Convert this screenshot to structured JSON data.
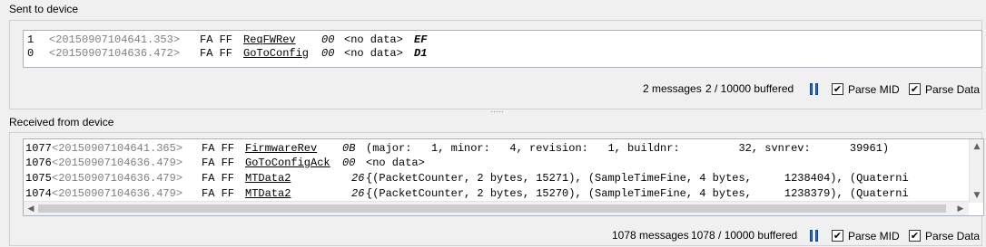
{
  "sent": {
    "title": "Sent to device",
    "rows": [
      {
        "idx": "1",
        "ts": "<20150907104641.353>",
        "hdr": "FA FF",
        "mid": "ReqFWRev",
        "len": "00",
        "data": "<no data>",
        "cs": "EF"
      },
      {
        "idx": "0",
        "ts": "<20150907104636.472>",
        "hdr": "FA FF",
        "mid": "GoToConfig",
        "len": "00",
        "data": "<no data>",
        "cs": "D1"
      }
    ],
    "status": {
      "messages": "2 messages",
      "buffered": "2 / 10000 buffered",
      "parse_mid_label": "Parse MID",
      "parse_data_label": "Parse Data",
      "parse_mid_checked": "✔",
      "parse_data_checked": "✔"
    }
  },
  "received": {
    "title": "Received from device",
    "rows": [
      {
        "idx": "1077",
        "ts": "<20150907104641.365>",
        "hdr": "FA FF",
        "mid": "FirmwareRev",
        "len": "0B",
        "data": "(major:   1, minor:   4, revision:   1, buildnr:         32, svnrev:      39961)"
      },
      {
        "idx": "1076",
        "ts": "<20150907104636.479>",
        "hdr": "FA FF",
        "mid": "GoToConfigAck",
        "len": "00",
        "data": "<no data>"
      },
      {
        "idx": "1075",
        "ts": "<20150907104636.479>",
        "hdr": "FA FF",
        "mid": "MTData2",
        "len": "26",
        "data": "{(PacketCounter, 2 bytes, 15271), (SampleTimeFine, 4 bytes,     1238404), (Quaterni"
      },
      {
        "idx": "1074",
        "ts": "<20150907104636.479>",
        "hdr": "FA FF",
        "mid": "MTData2",
        "len": "26",
        "data": "{(PacketCounter, 2 bytes, 15270), (SampleTimeFine, 4 bytes,     1238379), (Quaterni"
      }
    ],
    "status": {
      "messages": "1078 messages",
      "buffered": "1078 / 10000 buffered",
      "parse_mid_label": "Parse MID",
      "parse_data_label": "Parse Data",
      "parse_mid_checked": "✔",
      "parse_data_checked": "✔"
    }
  }
}
